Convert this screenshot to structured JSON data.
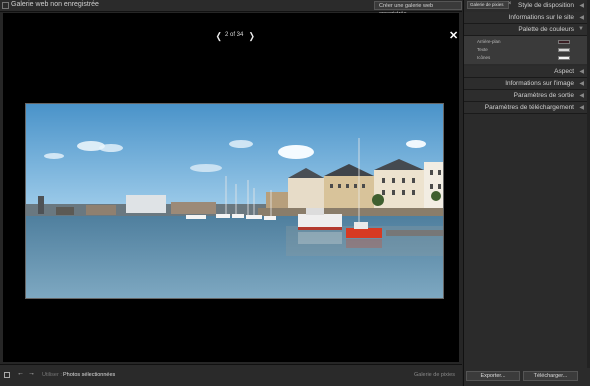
{
  "window": {
    "title": "Galerie web non enregistrée"
  },
  "toolbar": {
    "create_label": "Créer une galerie web enregistrée"
  },
  "preview": {
    "counter": "2 of 34",
    "prev_icon": "chevron-left-icon",
    "next_icon": "chevron-right-icon",
    "close_icon": "close-icon"
  },
  "bottom": {
    "use_label": "Utiliser :",
    "use_value": "Photos sélectionnées",
    "right_label": "Galerie de pixies"
  },
  "sidebar": {
    "search_value": "Galerie de pixies",
    "sections": [
      {
        "label": "Style de disposition"
      },
      {
        "label": "Informations sur le site"
      },
      {
        "label": "Palette de couleurs"
      },
      {
        "label": "Aspect"
      },
      {
        "label": "Informations sur l'image"
      },
      {
        "label": "Paramètres de sortie"
      },
      {
        "label": "Paramètres de téléchargement"
      }
    ],
    "color_palette": [
      {
        "label": "Arrière-plan",
        "color": "#3a1f24"
      },
      {
        "label": "Texte",
        "color": "#d9d9d9"
      },
      {
        "label": "Icônes",
        "color": "#f2f2f2"
      }
    ]
  },
  "footer": {
    "export_label": "Exporter...",
    "upload_label": "Télécharger..."
  },
  "colors": {
    "accent": "#cc3333",
    "background": "#262626"
  }
}
